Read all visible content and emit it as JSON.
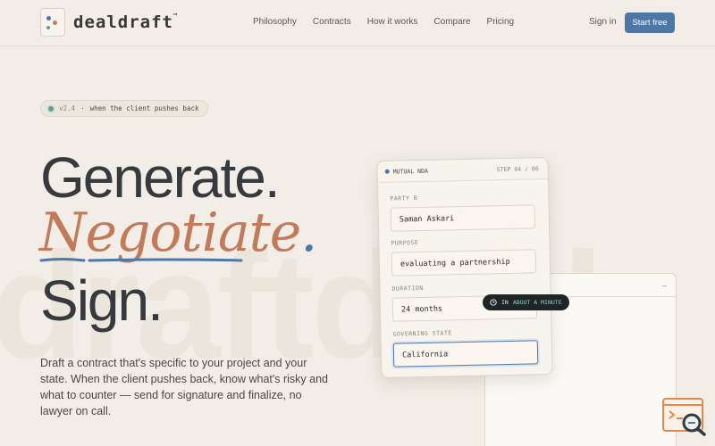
{
  "watermark": "draftdeal",
  "brand": {
    "name": "dealdraft",
    "tm": "™"
  },
  "nav": {
    "items": [
      {
        "label": "Philosophy"
      },
      {
        "label": "Contracts"
      },
      {
        "label": "How it works"
      },
      {
        "label": "Compare"
      },
      {
        "label": "Pricing"
      }
    ],
    "signin": "Sign in",
    "start": "Start free"
  },
  "pill": {
    "version": "v2.4",
    "sep": "·",
    "text": "when the client pushes back"
  },
  "hero": {
    "line1": "Generate.",
    "line2": "Negotiate",
    "line2_dot": ".",
    "line3": "Sign.",
    "description": "Draft a contract that's specific to your project and your state. When the client pushes back, know what's risky and what to counter — send for signature and finalize, no lawyer on call."
  },
  "form_card": {
    "title": "MUTUAL NDA",
    "step": "STEP 04 / 06",
    "fields": [
      {
        "label": "PARTY B",
        "value": "Saman Askari"
      },
      {
        "label": "PURPOSE",
        "value": "evaluating a partnership"
      },
      {
        "label": "DURATION",
        "value": "24 months"
      },
      {
        "label": "GOVERNING STATE",
        "value": "California"
      }
    ]
  },
  "badge": {
    "prefix": "IN",
    "emphasis": "ABOUT A MINUTE"
  },
  "back_card": {
    "control": "–"
  },
  "colors": {
    "accent_blue": "#4f77a6",
    "accent_terracotta": "#c17b5a",
    "background": "#f2ede6"
  }
}
